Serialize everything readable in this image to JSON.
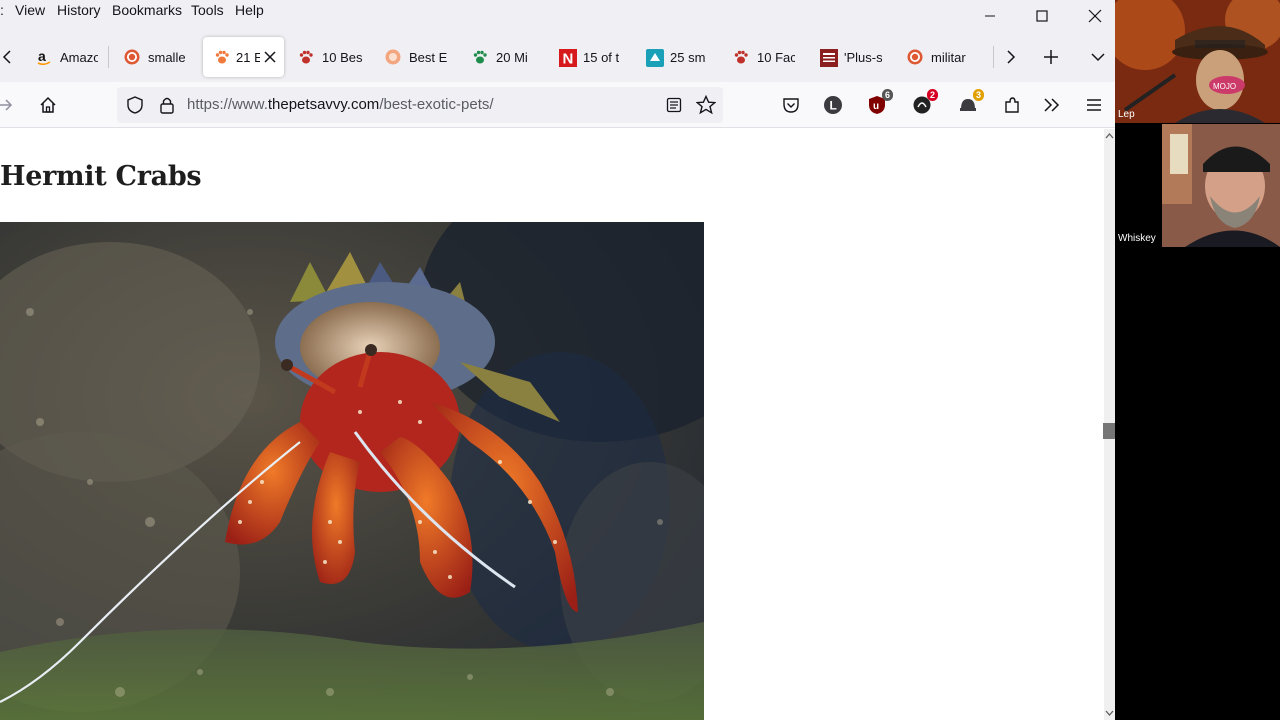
{
  "menubar": {
    "items": [
      "View",
      "History",
      "Bookmarks",
      "Tools",
      "Help"
    ]
  },
  "tabs": [
    {
      "title": "Amazo",
      "favicon": "amazon-icon"
    },
    {
      "title": "smalle",
      "favicon": "duckduckgo-icon"
    },
    {
      "title": "21 E",
      "favicon": "paw-icon",
      "active": true
    },
    {
      "title": "10 Bes",
      "favicon": "paw-icon"
    },
    {
      "title": "Best E",
      "favicon": "orange-circle-icon"
    },
    {
      "title": "20 Mi",
      "favicon": "green-paw-icon"
    },
    {
      "title": "15 of t",
      "favicon": "n-logo-icon"
    },
    {
      "title": "25 sm",
      "favicon": "teal-square-icon"
    },
    {
      "title": "10 Fac",
      "favicon": "paw-icon"
    },
    {
      "title": "'Plus-s",
      "favicon": "newspaper-icon"
    },
    {
      "title": "militar",
      "favicon": "duckduckgo-icon"
    }
  ],
  "navbar": {
    "url_prefix": "https://www.",
    "url_domain": "thepetsavvy.com",
    "url_path": "/best-exotic-pets/",
    "badges": {
      "ublock": "6",
      "ext2": "2",
      "ext3": "3"
    }
  },
  "page": {
    "heading": "Hermit Crabs"
  },
  "video": {
    "participants": [
      {
        "name": "Lep"
      },
      {
        "name": "Whiskey"
      }
    ]
  },
  "colors": {
    "accent": "#0060df",
    "tab_bg": "#f0f0f4",
    "crab_red": "#b3261e",
    "crab_orange": "#e0561c"
  }
}
